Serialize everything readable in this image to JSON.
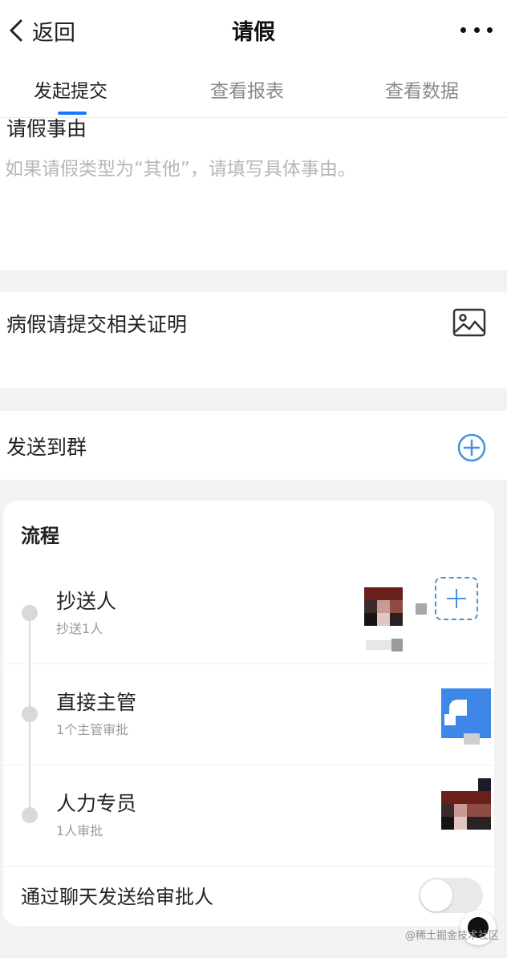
{
  "header": {
    "back_label": "返回",
    "title": "请假",
    "more_icon": "more-dots-icon"
  },
  "tabs": [
    {
      "label": "发起提交",
      "active": true
    },
    {
      "label": "查看报表",
      "active": false
    },
    {
      "label": "查看数据",
      "active": false
    }
  ],
  "reason": {
    "label": "请假事由",
    "placeholder": "如果请假类型为“其他”，请填写具体事由。",
    "value": ""
  },
  "proof": {
    "label": "病假请提交相关证明",
    "icon": "image-icon"
  },
  "send_group": {
    "label": "发送到群",
    "icon": "add-circle-icon"
  },
  "process": {
    "title": "流程",
    "steps": [
      {
        "name": "抄送人",
        "sub": "抄送1人"
      },
      {
        "name": "直接主管",
        "sub": "1个主管审批"
      },
      {
        "name": "人力专员",
        "sub": "1人审批"
      }
    ],
    "chat_toggle": {
      "label": "通过聊天发送给审批人",
      "on": false
    }
  },
  "watermark": "@稀土掘金技术社区",
  "colors": {
    "accent": "#1677ff",
    "icon_blue": "#4a90e2",
    "background": "#f2f2f2"
  }
}
